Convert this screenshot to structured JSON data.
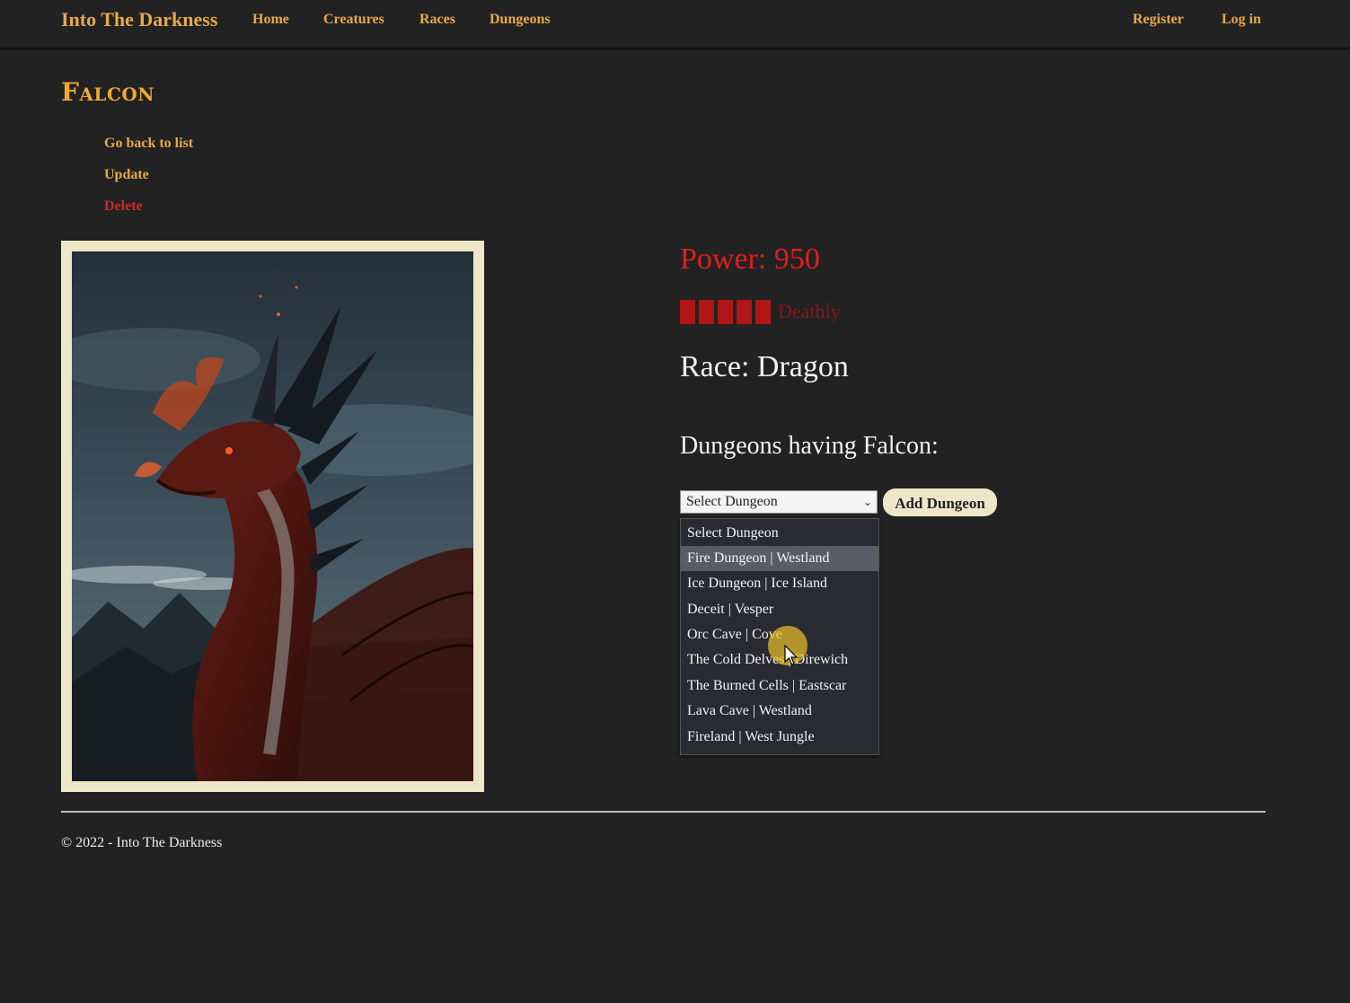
{
  "navbar": {
    "brand": "Into The Darkness",
    "links": [
      {
        "label": "Home"
      },
      {
        "label": "Creatures"
      },
      {
        "label": "Races"
      },
      {
        "label": "Dungeons"
      }
    ],
    "account": {
      "register": "Register",
      "login": "Log in"
    }
  },
  "creature": {
    "name": "Falcon",
    "actions": {
      "back": "Go back to list",
      "update": "Update",
      "delete": "Delete"
    },
    "image_icon": "dragon-illustration",
    "power_text": "Power: 950",
    "power_rating": {
      "filled_blocks": 5,
      "label": "Deathly"
    },
    "race_text": "Race: Dragon",
    "dungeons_heading": "Dungeons having Falcon:"
  },
  "dungeon_select": {
    "selected": "Select Dungeon",
    "add_button": "Add Dungeon",
    "highlighted_index": 1,
    "options": [
      "Select Dungeon",
      "Fire Dungeon | Westland",
      "Ice Dungeon | Ice Island",
      "Deceit | Vesper",
      "Orc Cave | Cove",
      "The Cold Delves | Direwich",
      "The Burned Cells | Eastscar",
      "Lava Cave | Westland",
      "Fireland | West Jungle"
    ]
  },
  "footer": {
    "text": "© 2022 - Into The Darkness"
  },
  "colors": {
    "background": "#222222",
    "nav_gold": "#e8a84a",
    "title_orange": "#f0a832",
    "delete_red": "#cc2b22",
    "power_red": "#e01e1e",
    "frame_cream": "#efe6c8"
  }
}
